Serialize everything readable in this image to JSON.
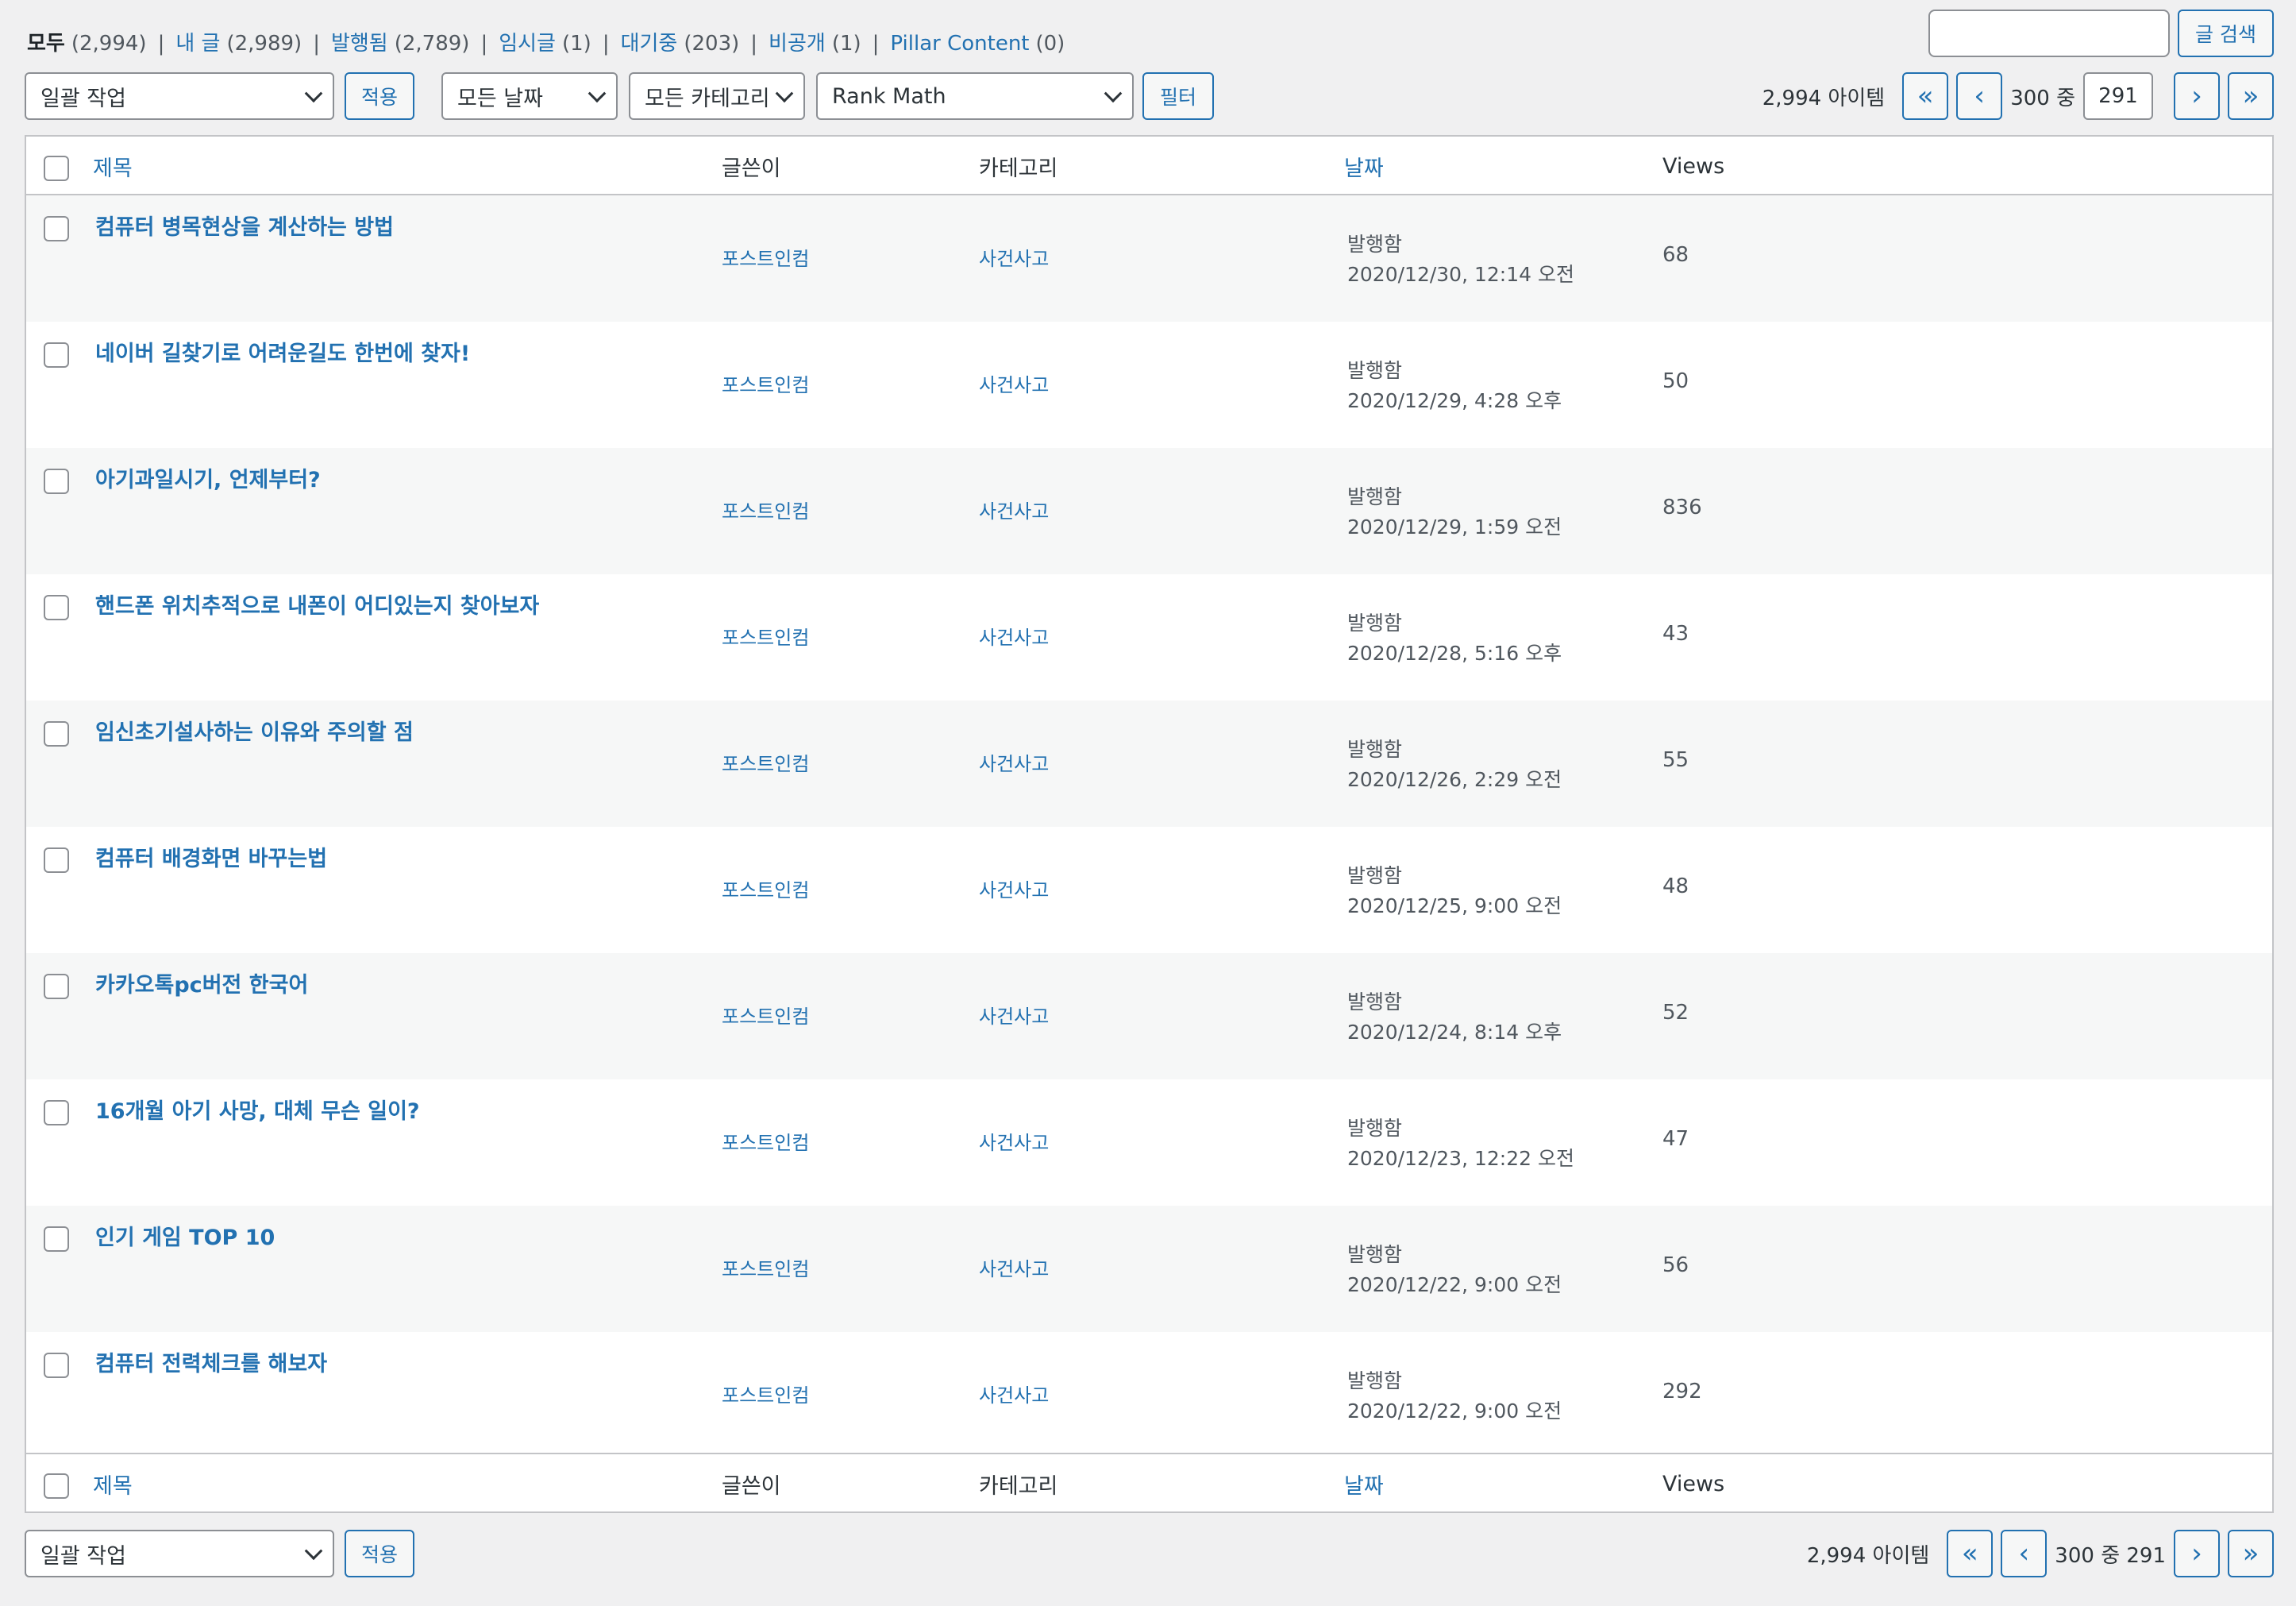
{
  "views_filter": {
    "all": {
      "label": "모두",
      "count": "(2,994)"
    },
    "mine": {
      "label": "내 글",
      "count": "(2,989)"
    },
    "published": {
      "label": "발행됨",
      "count": "(2,789)"
    },
    "draft": {
      "label": "임시글",
      "count": "(1)"
    },
    "pending": {
      "label": "대기중",
      "count": "(203)"
    },
    "private": {
      "label": "비공개",
      "count": "(1)"
    },
    "pillar": {
      "label": "Pillar Content",
      "count": "(0)"
    }
  },
  "search": {
    "button_label": "글 검색",
    "value": ""
  },
  "top_nav": {
    "bulk_action_value": "일괄 작업",
    "apply_label": "적용",
    "date_filter_value": "모든 날짜",
    "category_filter_value": "모든 카테고리",
    "seo_filter_value": "Rank Math",
    "filter_label": "필터",
    "items_count": "2,994 아이템",
    "first_page": "«",
    "prev_page": "‹",
    "current_page": "291",
    "page_of": "300 중",
    "next_page": "›",
    "last_page": "»"
  },
  "bottom_nav": {
    "bulk_action_value": "일괄 작업",
    "apply_label": "적용",
    "items_count": "2,994 아이템",
    "first_page": "«",
    "prev_page": "‹",
    "page_text": "300 중 291",
    "next_page": "›",
    "last_page": "»"
  },
  "columns": {
    "title": "제목",
    "author": "글쓴이",
    "categories": "카테고리",
    "date": "날짜",
    "views": "Views"
  },
  "posts": [
    {
      "title": "컴퓨터 병목현상을 계산하는 방법",
      "author": "포스트인컴",
      "category": "사건사고",
      "status": "발행함",
      "date": "2020/12/30, 12:14 오전",
      "views": "68"
    },
    {
      "title": "네이버 길찾기로 어려운길도 한번에 찾자!",
      "author": "포스트인컴",
      "category": "사건사고",
      "status": "발행함",
      "date": "2020/12/29, 4:28 오후",
      "views": "50"
    },
    {
      "title": "아기과일시기, 언제부터?",
      "author": "포스트인컴",
      "category": "사건사고",
      "status": "발행함",
      "date": "2020/12/29, 1:59 오전",
      "views": "836"
    },
    {
      "title": "핸드폰 위치추적으로 내폰이 어디있는지 찾아보자",
      "author": "포스트인컴",
      "category": "사건사고",
      "status": "발행함",
      "date": "2020/12/28, 5:16 오후",
      "views": "43"
    },
    {
      "title": "임신초기설사하는 이유와 주의할 점",
      "author": "포스트인컴",
      "category": "사건사고",
      "status": "발행함",
      "date": "2020/12/26, 2:29 오전",
      "views": "55"
    },
    {
      "title": "컴퓨터 배경화면 바꾸는법",
      "author": "포스트인컴",
      "category": "사건사고",
      "status": "발행함",
      "date": "2020/12/25, 9:00 오전",
      "views": "48"
    },
    {
      "title": "카카오톡pc버전 한국어",
      "author": "포스트인컴",
      "category": "사건사고",
      "status": "발행함",
      "date": "2020/12/24, 8:14 오후",
      "views": "52"
    },
    {
      "title": "16개월 아기 사망, 대체 무슨 일이?",
      "author": "포스트인컴",
      "category": "사건사고",
      "status": "발행함",
      "date": "2020/12/23, 12:22 오전",
      "views": "47"
    },
    {
      "title": "인기 게임 TOP 10",
      "author": "포스트인컴",
      "category": "사건사고",
      "status": "발행함",
      "date": "2020/12/22, 9:00 오전",
      "views": "56"
    },
    {
      "title": "컴퓨터 전력체크를 해보자",
      "author": "포스트인컴",
      "category": "사건사고",
      "status": "발행함",
      "date": "2020/12/22, 9:00 오전",
      "views": "292"
    }
  ]
}
